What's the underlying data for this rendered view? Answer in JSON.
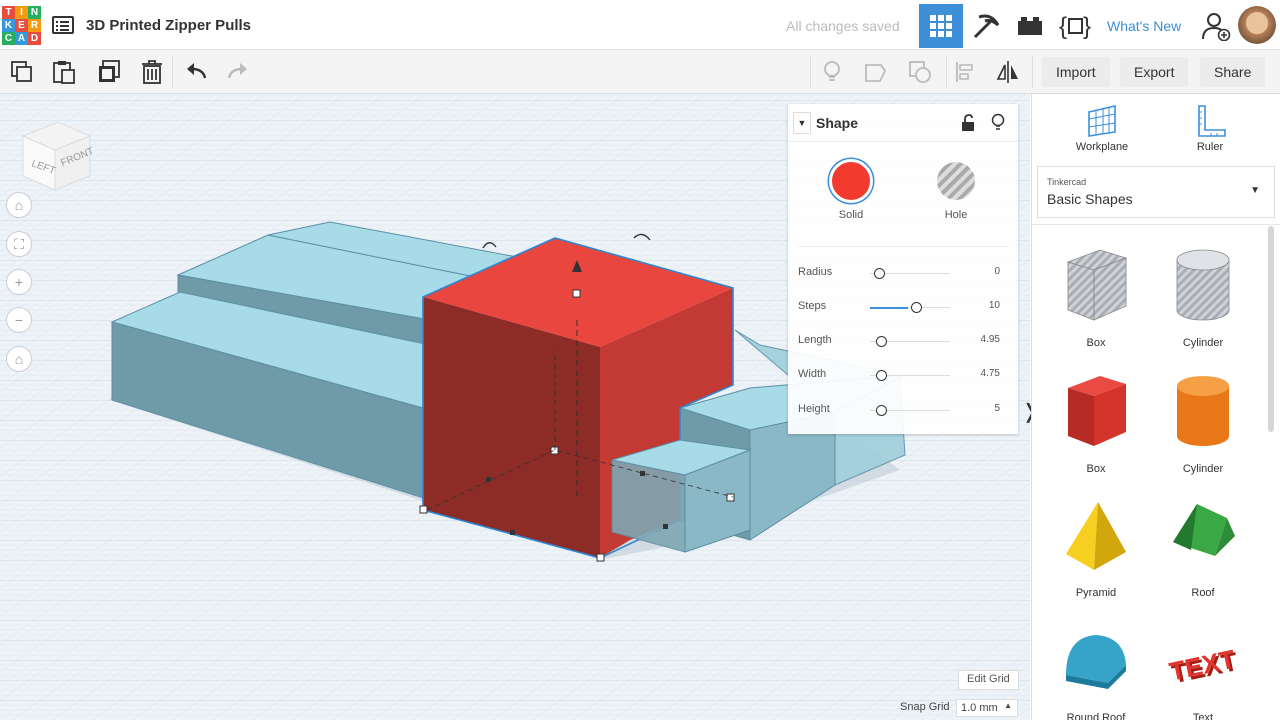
{
  "app": {
    "logo_letters": [
      "T",
      "I",
      "N",
      "K",
      "E",
      "R",
      "C",
      "A",
      "D"
    ]
  },
  "header": {
    "title": "3D Printed Zipper Pulls",
    "save_status": "All changes saved",
    "whats_new": "What's New"
  },
  "toolbar": {
    "import": "Import",
    "export": "Export",
    "share": "Share"
  },
  "viewcube": {
    "left": "LEFT",
    "front": "FRONT"
  },
  "inspector": {
    "title": "Shape",
    "solid_label": "Solid",
    "hole_label": "Hole",
    "solid_color": "#f23a2e",
    "properties": [
      {
        "label": "Radius",
        "value": "0"
      },
      {
        "label": "Steps",
        "value": "10"
      },
      {
        "label": "Length",
        "value": "4.95"
      },
      {
        "label": "Width",
        "value": "4.75"
      },
      {
        "label": "Height",
        "value": "5"
      }
    ]
  },
  "grid": {
    "edit_label": "Edit Grid",
    "snap_label": "Snap Grid",
    "snap_value": "1.0 mm"
  },
  "panel": {
    "workplane": "Workplane",
    "ruler": "Ruler",
    "library_source": "Tinkercad",
    "library_name": "Basic Shapes",
    "shapes": [
      {
        "label": "Box"
      },
      {
        "label": "Cylinder"
      },
      {
        "label": "Box"
      },
      {
        "label": "Cylinder"
      },
      {
        "label": "Pyramid"
      },
      {
        "label": "Roof"
      },
      {
        "label": "Round Roof"
      },
      {
        "label": "Text"
      }
    ]
  },
  "colors": {
    "accent": "#3d8fd8",
    "red": "#e9463f",
    "blue_shape": "#a8dbe8"
  }
}
